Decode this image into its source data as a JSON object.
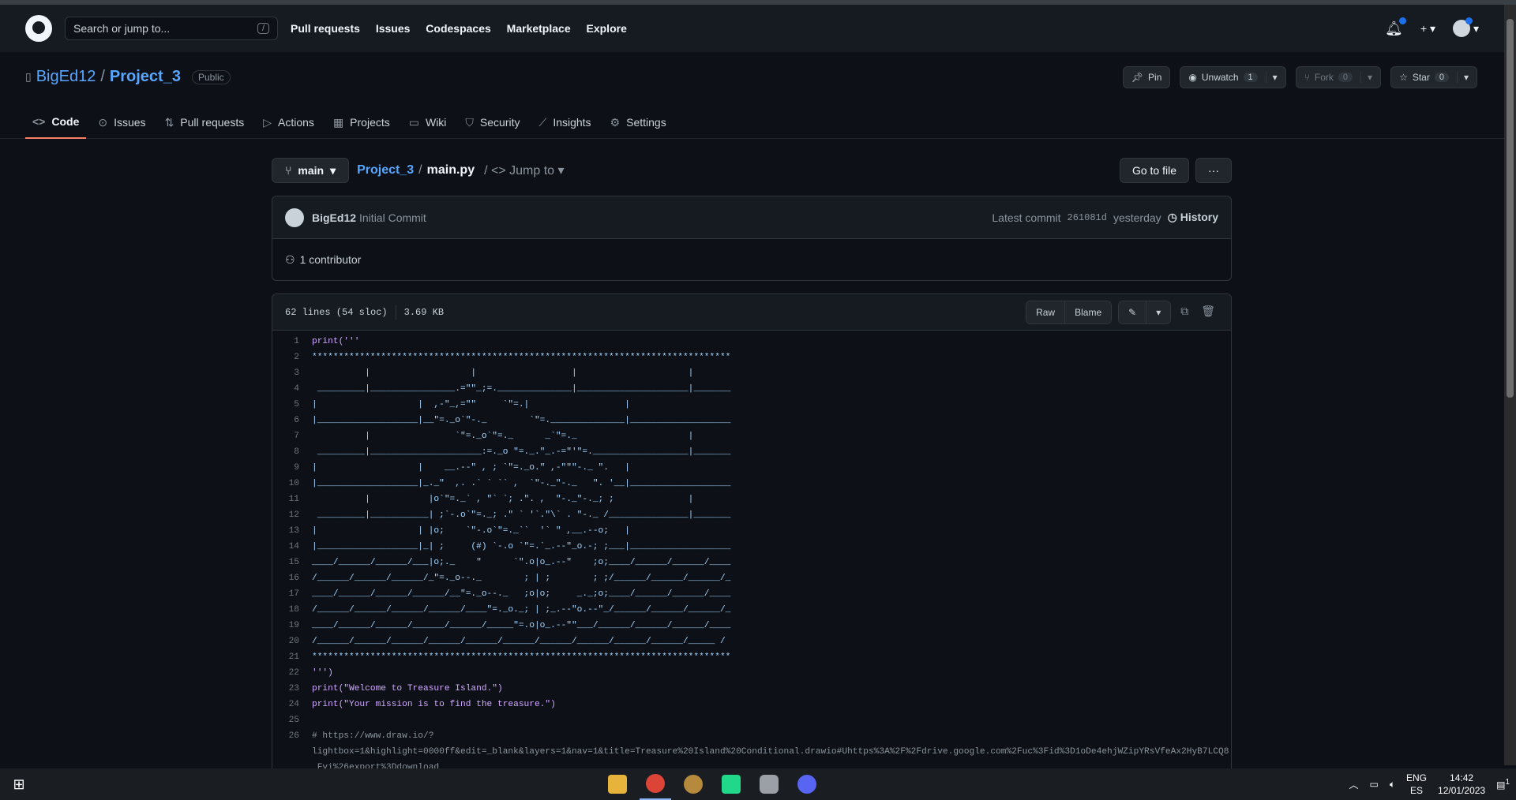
{
  "header": {
    "search_placeholder": "Search or jump to...",
    "slash": "/",
    "nav": [
      "Pull requests",
      "Issues",
      "Codespaces",
      "Marketplace",
      "Explore"
    ]
  },
  "repo": {
    "owner": "BigEd12",
    "name": "Project_3",
    "visibility": "Public",
    "pin": "Pin",
    "unwatch": "Unwatch",
    "watch_count": "1",
    "fork": "Fork",
    "fork_count": "0",
    "star": "Star",
    "star_count": "0"
  },
  "tabs": [
    {
      "label": "Code",
      "icon": "code-icon"
    },
    {
      "label": "Issues",
      "icon": "issue-icon"
    },
    {
      "label": "Pull requests",
      "icon": "pull-request-icon"
    },
    {
      "label": "Actions",
      "icon": "play-icon"
    },
    {
      "label": "Projects",
      "icon": "table-icon"
    },
    {
      "label": "Wiki",
      "icon": "book-icon"
    },
    {
      "label": "Security",
      "icon": "shield-icon"
    },
    {
      "label": "Insights",
      "icon": "graph-icon"
    },
    {
      "label": "Settings",
      "icon": "gear-icon"
    }
  ],
  "file": {
    "branch": "main",
    "repo_link": "Project_3",
    "slash": "/",
    "filename": "main.py",
    "jump": "/ <> Jump to",
    "goto": "Go to file",
    "more": "···"
  },
  "commit": {
    "author": "BigEd12",
    "message": "Initial Commit",
    "latest": "Latest commit",
    "sha": "261081d",
    "when": "yesterday",
    "history": "History",
    "contributors": "1 contributor"
  },
  "filehead": {
    "lines": "62 lines (54 sloc)",
    "size": "3.69 KB",
    "raw": "Raw",
    "blame": "Blame"
  },
  "code": [
    {
      "n": "1",
      "t": "print('''",
      "c": "kw"
    },
    {
      "n": "2",
      "t": "*******************************************************************************",
      "c": ""
    },
    {
      "n": "3",
      "t": "          |                   |                  |                     |",
      "c": ""
    },
    {
      "n": "4",
      "t": " _________|________________.=\"\"_;=.______________|_____________________|_______",
      "c": ""
    },
    {
      "n": "5",
      "t": "|                   |  ,-\"_,=\"\"     `\"=.|                  |",
      "c": ""
    },
    {
      "n": "6",
      "t": "|___________________|__\"=._o`\"-._        `\"=.______________|___________________",
      "c": ""
    },
    {
      "n": "7",
      "t": "          |                `\"=._o`\"=._      _`\"=._                     |",
      "c": ""
    },
    {
      "n": "8",
      "t": " _________|_____________________:=._o \"=._.\"_.-=\"'\"=.__________________|_______",
      "c": ""
    },
    {
      "n": "9",
      "t": "|                   |    __.--\" , ; `\"=._o.\" ,-\"\"\"-._ \".   |",
      "c": ""
    },
    {
      "n": "10",
      "t": "|___________________|_._\"  ,. .` ` `` ,  `\"-._\"-._   \". '__|___________________",
      "c": ""
    },
    {
      "n": "11",
      "t": "          |           |o`\"=._` , \"` `; .\". ,  \"-._\"-._; ;              |",
      "c": ""
    },
    {
      "n": "12",
      "t": " _________|___________| ;`-.o`\"=._; .\" ` '`.\"\\` . \"-._ /_______________|_______",
      "c": ""
    },
    {
      "n": "13",
      "t": "|                   | |o;    `\"-.o`\"=._``  '` \" ,__.--o;   |",
      "c": ""
    },
    {
      "n": "14",
      "t": "|___________________|_| ;     (#) `-.o `\"=.`_.--\"_o.-; ;___|___________________",
      "c": ""
    },
    {
      "n": "15",
      "t": "____/______/______/___|o;._    \"      `\".o|o_.--\"    ;o;____/______/______/____",
      "c": ""
    },
    {
      "n": "16",
      "t": "/______/______/______/_\"=._o--._        ; | ;        ; ;/______/______/______/_",
      "c": ""
    },
    {
      "n": "17",
      "t": "____/______/______/______/__\"=._o--._   ;o|o;     _._;o;____/______/______/____",
      "c": ""
    },
    {
      "n": "18",
      "t": "/______/______/______/______/____\"=._o._; | ;_.--\"o.--\"_/______/______/______/_",
      "c": ""
    },
    {
      "n": "19",
      "t": "____/______/______/______/______/_____\"=.o|o_.--\"\"___/______/______/______/____",
      "c": ""
    },
    {
      "n": "20",
      "t": "/______/______/______/______/______/______/______/______/______/______/_____ /",
      "c": ""
    },
    {
      "n": "21",
      "t": "*******************************************************************************",
      "c": ""
    },
    {
      "n": "22",
      "t": "''')",
      "c": "kw"
    },
    {
      "n": "23",
      "t": "print(\"Welcome to Treasure Island.\")",
      "c": "kw"
    },
    {
      "n": "24",
      "t": "print(\"Your mission is to find the treasure.\")",
      "c": "kw"
    },
    {
      "n": "25",
      "t": "",
      "c": ""
    },
    {
      "n": "26",
      "t": "# https://www.draw.io/?",
      "c": "cm"
    },
    {
      "n": "",
      "t": "lightbox=1&highlight=0000ff&edit=_blank&layers=1&nav=1&title=Treasure%20Island%20Conditional.drawio#Uhttps%3A%2F%2Fdrive.google.com%2Fuc%3Fid%3D1oDe4ehjWZipYRsVfeAx2HyB7LCQ8",
      "c": "cm"
    },
    {
      "n": "",
      "t": " Fvi%26export%3Ddownload",
      "c": "cm"
    }
  ],
  "taskbar": {
    "lang1": "ENG",
    "lang2": "ES",
    "time": "14:42",
    "date": "12/01/2023",
    "notif": "1"
  }
}
